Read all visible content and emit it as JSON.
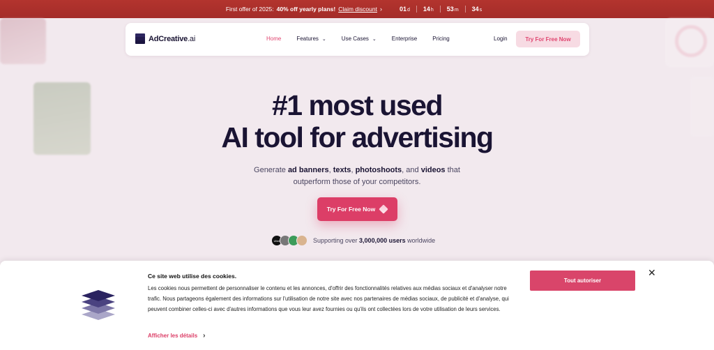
{
  "promo": {
    "text": "First offer of 2025:",
    "bold": "40% off yearly plans!",
    "link": "Claim discount",
    "chevron": "›",
    "countdown": [
      {
        "value": "01",
        "unit": "d"
      },
      {
        "value": "14",
        "unit": "h"
      },
      {
        "value": "53",
        "unit": "m"
      },
      {
        "value": "34",
        "unit": "s"
      }
    ]
  },
  "nav": {
    "logo_main": "AdCreative",
    "logo_suffix": ".ai",
    "items": [
      {
        "label": "Home",
        "active": true
      },
      {
        "label": "Features",
        "caret": "⌄"
      },
      {
        "label": "Use Cases",
        "caret": "⌄"
      },
      {
        "label": "Enterprise"
      },
      {
        "label": "Pricing"
      }
    ],
    "login": "Login",
    "cta": "Try For Free Now"
  },
  "hero": {
    "title_line1": "#1 most used",
    "title_line2": "AI tool for advertising",
    "sub1_a": "Generate ",
    "sub1_b": "ad banners",
    "sub1_c": ", ",
    "sub1_d": "texts",
    "sub1_e": ", ",
    "sub1_f": "photoshoots",
    "sub1_g": ", and ",
    "sub1_h": "videos",
    "sub1_i": " that",
    "sub2": "outperform those of your competitors.",
    "cta": "Try For Free Now",
    "support_a": "Supporting over ",
    "support_b": "3,000,000 users",
    "support_c": " worldwide",
    "avatar_1_label": "Uber"
  },
  "cookie": {
    "title": "Ce site web utilise des cookies.",
    "body": "Les cookies nous permettent de personnaliser le contenu et les annonces, d'offrir des fonctionnalités relatives aux médias sociaux et d'analyser notre trafic. Nous partageons également des informations sur l'utilisation de notre site avec nos partenaires de médias sociaux, de publicité et d'analyse, qui peuvent combiner celles-ci avec d'autres informations que vous leur avez fournies ou qu'ils ont collectées lors de votre utilisation de leurs services.",
    "details_link": "Afficher les détails",
    "details_chevron": "›",
    "allow_button": "Tout autoriser",
    "close": "✕"
  },
  "colors": {
    "brand_pink": "#dc3e67",
    "promo_red": "#a42c29",
    "navy": "#1a1433"
  }
}
